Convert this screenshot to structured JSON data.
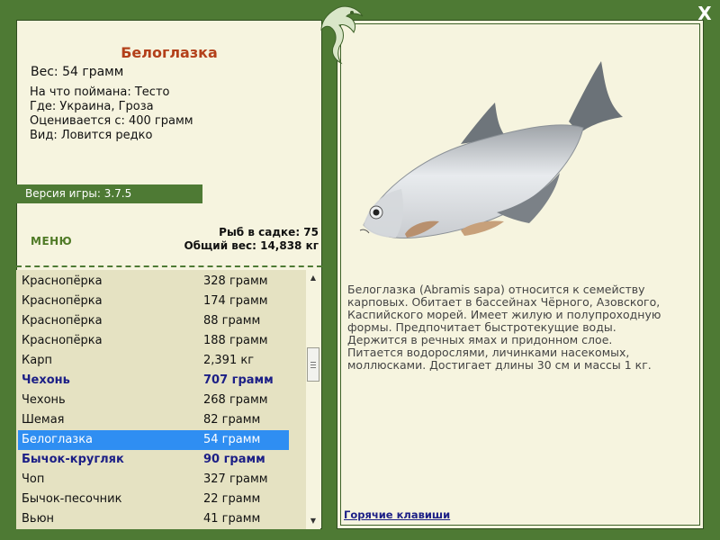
{
  "close": {
    "label": "X"
  },
  "fish": {
    "name": "Белоглазка",
    "weight": "Вес: 54 грамм",
    "bait": "На что поймана: Тесто",
    "location": "Где: Украина, Гроза",
    "value": "Оценивается с: 400 грамм",
    "rarity": "Вид: Ловится редко"
  },
  "version": "Версия игры: 3.7.5",
  "menu": {
    "label": "МЕНЮ"
  },
  "stats": {
    "count": "Рыб в садке: 75",
    "total": "Общий вес: 14,838 кг"
  },
  "catch_list": [
    {
      "name": "Краснопёрка",
      "weight": "328 грамм",
      "style": "normal"
    },
    {
      "name": "Краснопёрка",
      "weight": "174 грамм",
      "style": "normal"
    },
    {
      "name": "Краснопёрка",
      "weight": "88 грамм",
      "style": "normal"
    },
    {
      "name": "Краснопёрка",
      "weight": "188 грамм",
      "style": "normal"
    },
    {
      "name": "Карп",
      "weight": "2,391 кг",
      "style": "normal"
    },
    {
      "name": "Чехонь",
      "weight": "707 грамм",
      "style": "bold"
    },
    {
      "name": "Чехонь",
      "weight": "268 грамм",
      "style": "normal"
    },
    {
      "name": "Шемая",
      "weight": "82 грамм",
      "style": "normal"
    },
    {
      "name": "Белоглазка",
      "weight": "54 грамм",
      "style": "selected"
    },
    {
      "name": "Бычок-кругляк",
      "weight": "90 грамм",
      "style": "bold"
    },
    {
      "name": "Чоп",
      "weight": "327 грамм",
      "style": "normal"
    },
    {
      "name": "Бычок-песочник",
      "weight": "22 грамм",
      "style": "normal"
    },
    {
      "name": "Вьюн",
      "weight": "41 грамм",
      "style": "normal"
    }
  ],
  "description": "Белоглазка (Abramis sapa) относится к семейству карповых. Обитает в бассейнах Чёрного, Азовского, Каспийского морей. Имеет жилую и полупроходную формы. Предпочитает быстротекущие воды. Держится в речных ямах и придонном слое. Питается водорослями, личинками насекомых, моллюсками. Достигает длины 30 см и массы 1 кг.",
  "hotkeys": {
    "label": "Горячие клавиши"
  },
  "icons": {
    "close": "close-icon",
    "logo": "lizard-logo-icon",
    "fish": "fish-image"
  },
  "colors": {
    "frame": "#4e7a34",
    "panel": "#f6f4df",
    "list": "#e5e2c2",
    "title": "#b3401a",
    "selection": "#2f8ef2",
    "bold_row": "#1c1f86"
  }
}
